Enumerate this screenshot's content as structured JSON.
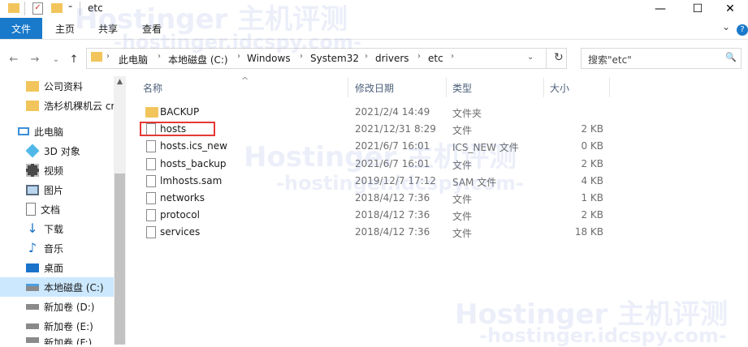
{
  "window": {
    "title": "etc",
    "minimize": "—",
    "maximize": "☐",
    "close": "✕"
  },
  "ribbon": {
    "file": "文件",
    "home": "主页",
    "share": "共享",
    "view": "查看",
    "expand": "⌄",
    "help": "?"
  },
  "address": {
    "crumbs": [
      "此电脑",
      "本地磁盘 (C:)",
      "Windows",
      "System32",
      "drivers",
      "etc"
    ],
    "refresh": "↻"
  },
  "search": {
    "placeholder": "搜索\"etc\"",
    "icon": "🔍"
  },
  "nav": {
    "items": [
      {
        "label": "公司资料",
        "icon": "folder-icon"
      },
      {
        "label": "浩杉机稞机云 cr",
        "icon": "folder-icon"
      },
      {
        "label": "此电脑",
        "icon": "computer-icon"
      },
      {
        "label": "3D 对象",
        "icon": "cube-icon"
      },
      {
        "label": "视频",
        "icon": "video-icon"
      },
      {
        "label": "图片",
        "icon": "picture-icon"
      },
      {
        "label": "文档",
        "icon": "document-icon"
      },
      {
        "label": "下载",
        "icon": "download-icon"
      },
      {
        "label": "音乐",
        "icon": "music-icon"
      },
      {
        "label": "桌面",
        "icon": "desktop-icon"
      },
      {
        "label": "本地磁盘 (C:)",
        "icon": "drive-icon"
      },
      {
        "label": "新加卷 (D:)",
        "icon": "drive-icon"
      },
      {
        "label": "新加卷 (E:)",
        "icon": "drive-icon"
      },
      {
        "label": "新加卷 (F:)",
        "icon": "drive-icon"
      }
    ]
  },
  "columns": {
    "name": "名称",
    "date": "修改日期",
    "type": "类型",
    "size": "大小",
    "sort_icon": "^"
  },
  "files": [
    {
      "name": "BACKUP",
      "date": "2021/2/4 14:49",
      "type": "文件夹",
      "size": "",
      "icon": "folder-icon"
    },
    {
      "name": "hosts",
      "date": "2021/12/31 8:29",
      "type": "文件",
      "size": "2 KB",
      "icon": "file-icon"
    },
    {
      "name": "hosts.ics_new",
      "date": "2021/6/7 16:01",
      "type": "ICS_NEW 文件",
      "size": "0 KB",
      "icon": "file-icon"
    },
    {
      "name": "hosts_backup",
      "date": "2021/6/7 16:01",
      "type": "文件",
      "size": "2 KB",
      "icon": "file-icon"
    },
    {
      "name": "lmhosts.sam",
      "date": "2019/12/7 17:12",
      "type": "SAM 文件",
      "size": "4 KB",
      "icon": "file-icon"
    },
    {
      "name": "networks",
      "date": "2018/4/12 7:36",
      "type": "文件",
      "size": "1 KB",
      "icon": "file-icon"
    },
    {
      "name": "protocol",
      "date": "2018/4/12 7:36",
      "type": "文件",
      "size": "2 KB",
      "icon": "file-icon"
    },
    {
      "name": "services",
      "date": "2018/4/12 7:36",
      "type": "文件",
      "size": "18 KB",
      "icon": "file-icon"
    }
  ],
  "watermark": {
    "brand": "Hostinger 主机评测",
    "url": "-hostinger.idcspy.com-"
  },
  "colors": {
    "accent": "#1979ca",
    "highlight_box": "#e53935",
    "selected_nav": "#cce8ff"
  }
}
